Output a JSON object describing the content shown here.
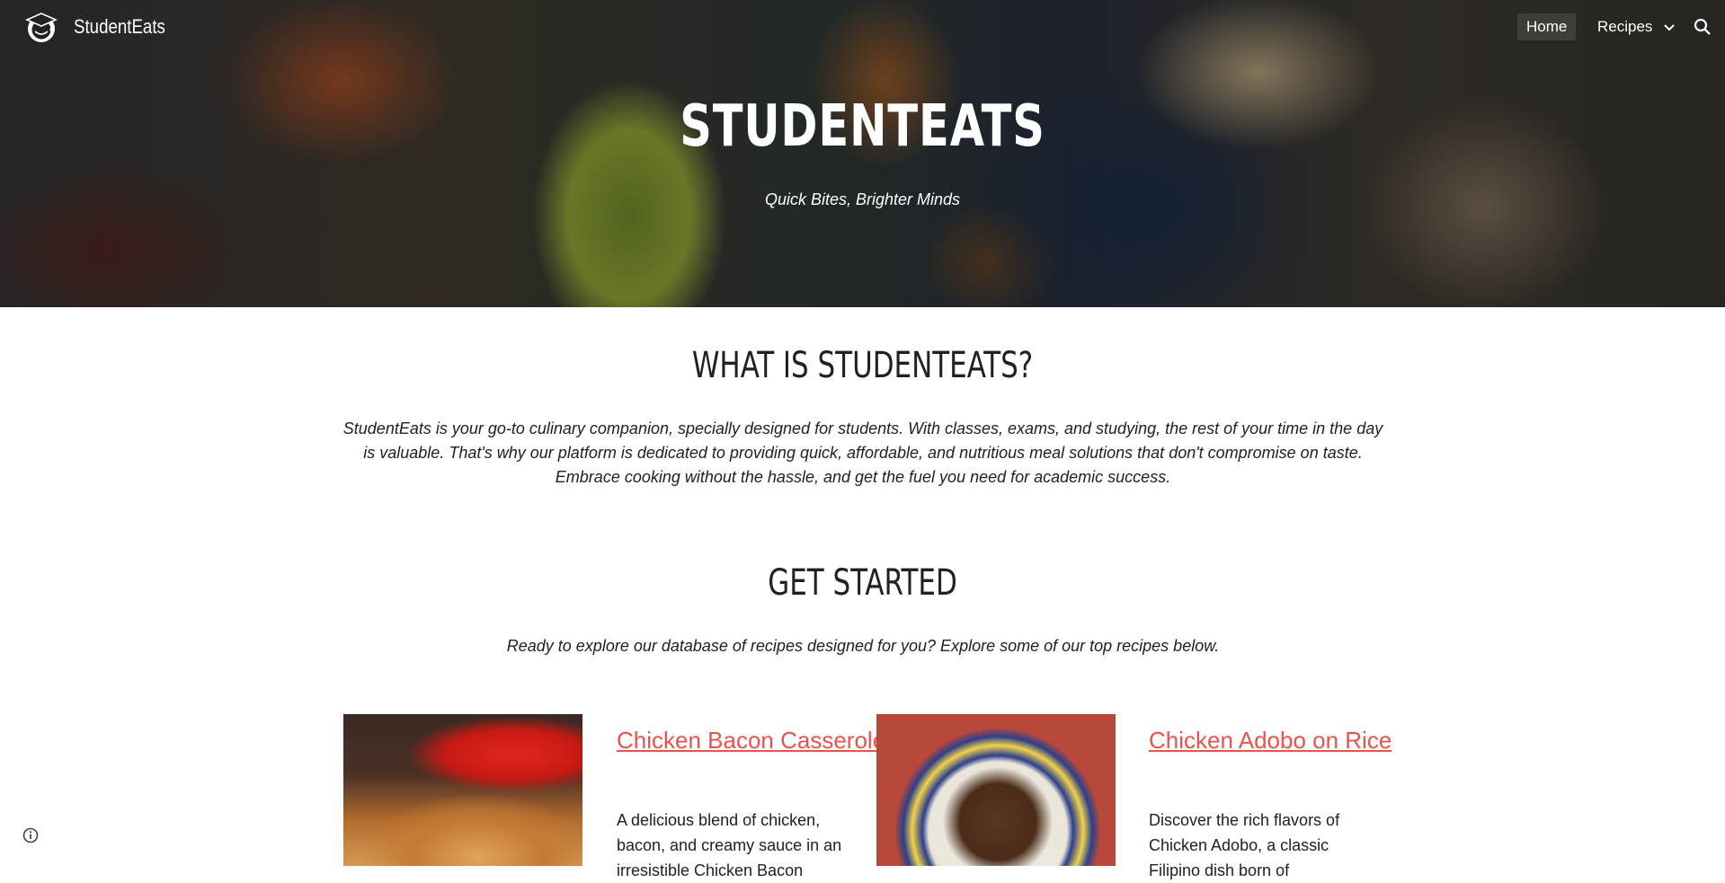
{
  "header": {
    "site_name": "StudentEats",
    "nav": {
      "home": "Home",
      "recipes": "Recipes"
    },
    "icons": {
      "logo": "student-cap-logo",
      "dropdown": "chevron-down-icon",
      "search": "search-icon"
    }
  },
  "hero": {
    "title": "STUDENTEATS",
    "subtitle": "Quick Bites, Brighter Minds"
  },
  "about": {
    "heading": "WHAT IS STUDENTEATS?",
    "body": "StudentEats is your go-to culinary companion, specially designed for students. With classes, exams, and studying, the rest of your time in the day is valuable. That's why our platform is dedicated to providing quick, affordable, and nutritious meal solutions that don't compromise on taste. Embrace cooking without the hassle, and get the fuel you need for academic success."
  },
  "get_started": {
    "heading": "GET STARTED",
    "body": "Ready to explore our database of recipes designed for you? Explore some of our top recipes below."
  },
  "recipes": [
    {
      "title": "Chicken Bacon Casserole",
      "description": "A delicious blend of chicken, bacon, and creamy sauce in an irresistible Chicken Bacon"
    },
    {
      "title": "Chicken Adobo on Rice",
      "description": "Discover the rich flavors of Chicken Adobo, a classic Filipino dish born of"
    }
  ],
  "colors": {
    "link": "#e8534b",
    "text": "#212121"
  }
}
